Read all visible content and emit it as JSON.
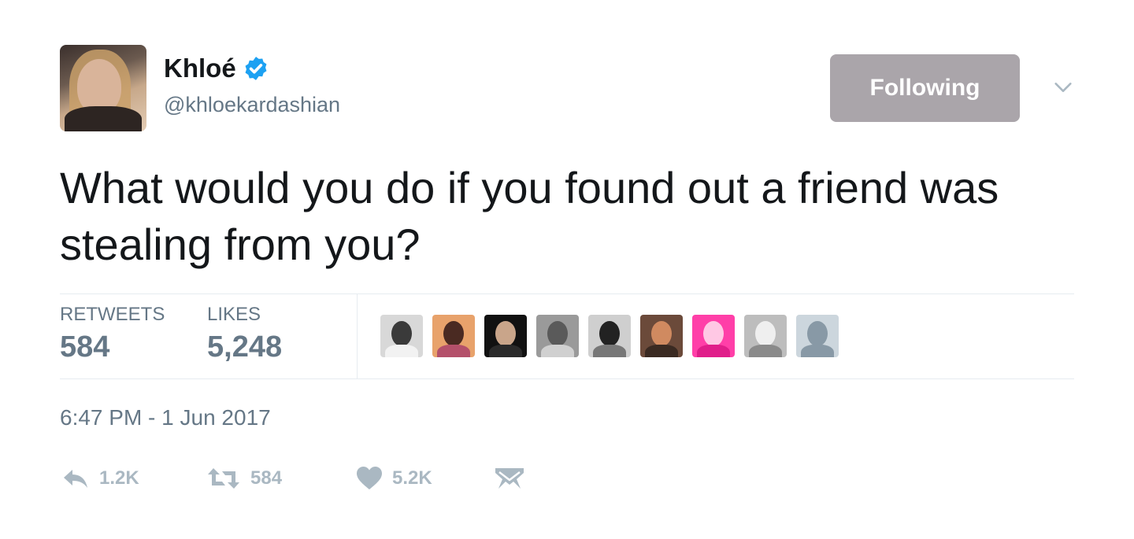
{
  "author": {
    "name": "Khloé",
    "handle": "@khloekardashian",
    "verified": true
  },
  "follow_button": {
    "label": "Following"
  },
  "tweet": {
    "text": "What would you do if you found out a friend was stealing from you?",
    "timestamp": "6:47 PM - 1 Jun 2017"
  },
  "stats": {
    "retweets_label": "RETWEETS",
    "retweets_value": "584",
    "likes_label": "LIKES",
    "likes_value": "5,248"
  },
  "likers": [
    {
      "name": "liker-1",
      "bg": "#d8d8d8",
      "head": "#3a3a3a",
      "shoulder": "#f2f2f2"
    },
    {
      "name": "liker-2",
      "bg": "#e8a26b",
      "head": "#4a2a22",
      "shoulder": "#b4506a"
    },
    {
      "name": "liker-3",
      "bg": "#111111",
      "head": "#c9a58a",
      "shoulder": "#2a2a2a"
    },
    {
      "name": "liker-4",
      "bg": "#9a9a9a",
      "head": "#5a5a5a",
      "shoulder": "#d0d0d0"
    },
    {
      "name": "liker-5",
      "bg": "#cfcfcf",
      "head": "#222222",
      "shoulder": "#777777"
    },
    {
      "name": "liker-6",
      "bg": "#6b4a3a",
      "head": "#d08a60",
      "shoulder": "#3a2a22"
    },
    {
      "name": "liker-7",
      "bg": "#ff3fa8",
      "head": "#ffc8e4",
      "shoulder": "#e01e8a"
    },
    {
      "name": "liker-8",
      "bg": "#bdbdbd",
      "head": "#efefef",
      "shoulder": "#8a8a8a"
    },
    {
      "name": "liker-default",
      "bg": "#ccd6dd",
      "head": "#8899a6",
      "shoulder": "#8899a6"
    }
  ],
  "actions": {
    "reply_count": "1.2K",
    "retweet_count": "584",
    "like_count": "5.2K"
  },
  "icons": {
    "verified": "verified-badge-icon",
    "chevron": "chevron-down-icon",
    "reply": "reply-icon",
    "retweet": "retweet-icon",
    "like": "heart-icon",
    "dm": "direct-message-icon"
  },
  "colors": {
    "verified": "#1da1f2",
    "follow_button_bg": "#aaa5aa",
    "secondary_text": "#657786",
    "action_icon": "#aab8c2"
  }
}
